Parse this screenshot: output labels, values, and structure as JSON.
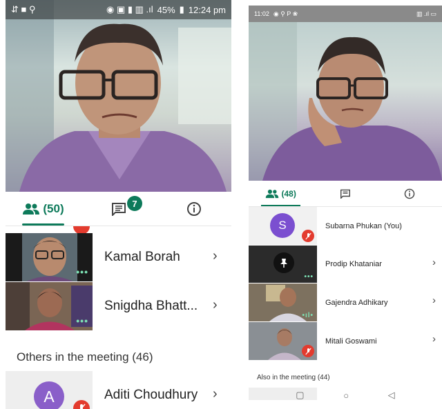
{
  "left": {
    "status": {
      "battery": "45%",
      "time": "12:24 pm"
    },
    "tabs": {
      "people_count": "(50)",
      "chat_badge": "7"
    },
    "participants": [
      {
        "name": "Kamal Borah"
      },
      {
        "name": "Snigdha Bhatt..."
      }
    ],
    "others_header": "Others in the meeting (46)",
    "others": [
      {
        "initial": "A",
        "name": "Aditi Choudhury"
      }
    ]
  },
  "right": {
    "status": {
      "time": "11:02"
    },
    "tabs": {
      "people_count": "(48)"
    },
    "participants": [
      {
        "initial": "S",
        "name": "Subarna Phukan (You)"
      },
      {
        "name": "Prodip Khataniar"
      },
      {
        "name": "Gajendra Adhikary"
      },
      {
        "name": "Mitali Goswami"
      }
    ],
    "also_header": "Also in the meeting (44)"
  },
  "colors": {
    "accent": "#0d7a5a",
    "mute_red": "#e33b2e",
    "avatar_purple": "#8a5fc9",
    "avatar_purple_dark": "#7b4fd0"
  },
  "icons": [
    "people-icon",
    "chat-icon",
    "info-icon",
    "chevron-right-icon",
    "mic-off-icon",
    "pin-icon",
    "audio-dots-icon",
    "wifi-icon",
    "battery-icon",
    "back-icon",
    "home-icon",
    "recents-icon"
  ]
}
